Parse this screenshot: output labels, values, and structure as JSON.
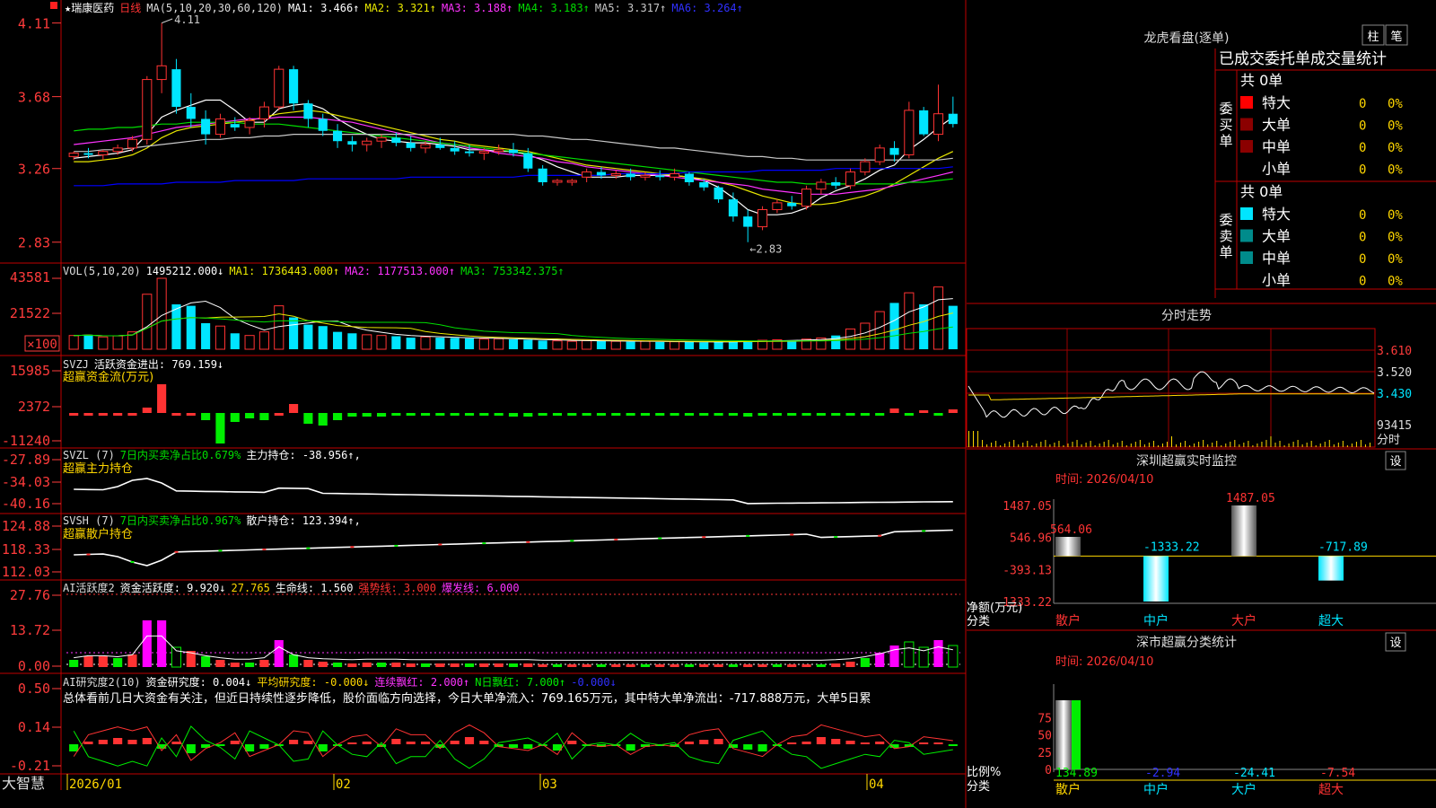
{
  "stock": {
    "name": "瑞康医药",
    "period": "日线",
    "star": "★"
  },
  "colors": {
    "up": "#ff3333",
    "down": "#00e5ff",
    "grid": "#9b0000",
    "panelBorder": "#c00000",
    "axis": "#ff3b3b",
    "ma1": "#ffffff",
    "ma2": "#e8e800",
    "ma3": "#ff33ff",
    "ma4": "#00dd00",
    "ma5": "#c8c8c8",
    "ma6": "#0000ff"
  },
  "main": {
    "header": [
      "MA(5,10,20,30,60,120)",
      "MA1: 3.466↑",
      "MA2: 3.321↑",
      "MA3: 3.188↑",
      "MA4: 3.183↑",
      "MA5: 3.317↑",
      "MA6: 3.264↑"
    ],
    "yTicks": [
      "4.11",
      "3.68",
      "3.26",
      "2.83"
    ],
    "highNote": "4.11",
    "lowNote": "←2.83",
    "ylim": [
      2.75,
      4.15
    ]
  },
  "vol": {
    "header": [
      "VOL(5,10,20)",
      "1495212.000↓",
      "MA1: 1736443.000↑",
      "MA2: 1177513.000↑",
      "MA3: 753342.375↑"
    ],
    "yTicks": [
      "43581",
      "21522",
      "×100"
    ]
  },
  "svzj": {
    "header": [
      "SVZJ",
      "活跃资金进出: 769.159↓"
    ],
    "title": "超赢资金流(万元)",
    "yTicks": [
      "15985",
      "2372",
      "-11240"
    ]
  },
  "svzl": {
    "header": [
      "SVZL (7)",
      "7日内买卖净占比0.679%",
      "主力持仓: -38.956↑,"
    ],
    "title": "超赢主力持仓",
    "yTicks": [
      "-27.89",
      "-34.03",
      "-40.16"
    ]
  },
  "svsh": {
    "header": [
      "SVSH (7)",
      "7日内买卖净占比0.967%",
      "散户持仓: 123.394↑,"
    ],
    "title": "超赢散户持仓",
    "yTicks": [
      "124.88",
      "118.33",
      "112.03"
    ]
  },
  "ai1": {
    "header": [
      "AI活跃度2",
      "资金活跃度: 9.920↓",
      "27.765",
      "生命线: 1.560",
      "强势线: 3.000",
      "爆发线: 6.000"
    ],
    "yTicks": [
      "27.76",
      "13.72",
      "0.00"
    ]
  },
  "ai2": {
    "header": [
      "AI研究度2(10)",
      "资金研究度: 0.004↓",
      "平均研究度: -0.000↓",
      "连续飘红: 2.000↑",
      "N日飘红: 7.000↑",
      "-0.000↓"
    ],
    "text": "总体看前几日大资金有关注，但近日持续性逐步降低，股价面临方向选择，今日大单净流入：769.165万元，其中特大单净流出：-717.888万元，大单5日累",
    "yTicks": [
      "0.50",
      "0.14",
      "-0.21"
    ]
  },
  "dateAxis": [
    "2026/01",
    "02",
    "03",
    "04"
  ],
  "brand": "大智慧",
  "right": {
    "title": "龙虎看盘(逐单)",
    "tabs": [
      "柱",
      "笔"
    ],
    "tableTitle": "已成交委托单成交量统计",
    "buy": {
      "side": "委买单",
      "total": "共 0单",
      "rows": [
        {
          "label": "特大",
          "val": "0",
          "pct": "0%"
        },
        {
          "label": "大单",
          "val": "0",
          "pct": "0%"
        },
        {
          "label": "中单",
          "val": "0",
          "pct": "0%"
        },
        {
          "label": "小单",
          "val": "0",
          "pct": "0%"
        }
      ]
    },
    "sell": {
      "side": "委卖单",
      "total": "共 0单",
      "rows": [
        {
          "label": "特大",
          "val": "0",
          "pct": "0%"
        },
        {
          "label": "大单",
          "val": "0",
          "pct": "0%"
        },
        {
          "label": "中单",
          "val": "0",
          "pct": "0%"
        },
        {
          "label": "小单",
          "val": "0",
          "pct": "0%"
        }
      ]
    },
    "intraday": {
      "title": "分时走势",
      "yTicks": [
        "3.610",
        "3.520",
        "3.430",
        "93415"
      ],
      "footer": "分时"
    },
    "monitor": {
      "title": "深圳超赢实时监控",
      "setBtn": "设",
      "date": "时间: 2026/04/10",
      "yTicks": [
        "1487.05",
        "546.96",
        "-393.13",
        "-1333.22"
      ],
      "ylabel": "净额(万元)",
      "xlabel": "分类",
      "categories": [
        "散户",
        "中户",
        "大户",
        "超大"
      ],
      "values": [
        564.06,
        -1333.22,
        1487.05,
        -717.89
      ],
      "valueLabels": [
        "564.06",
        "-1333.22",
        "1487.05",
        "-717.89"
      ]
    },
    "stats": {
      "title": "深市超赢分类统计",
      "setBtn": "设",
      "date": "时间: 2026/04/10",
      "yTicks": [
        "75",
        "50",
        "25",
        "0"
      ],
      "ylabel": "比例%",
      "xlabel": "分类",
      "categories": [
        "散户",
        "中户",
        "大户",
        "超大"
      ],
      "values": [
        134.89,
        -2.94,
        -24.41,
        -7.54
      ],
      "valueLabels": [
        "134.89",
        "-2.94",
        "-24.41",
        "-7.54"
      ]
    }
  },
  "chart_data": {
    "type": "candlestick",
    "title": "瑞康医药 日线",
    "x": [
      "2026/01",
      "02",
      "03",
      "04"
    ],
    "ylim": [
      2.75,
      4.15
    ],
    "high": 4.11,
    "low": 2.83,
    "ohlc": [
      [
        3.33,
        3.36,
        3.31,
        3.35
      ],
      [
        3.35,
        3.38,
        3.32,
        3.34
      ],
      [
        3.34,
        3.37,
        3.31,
        3.36
      ],
      [
        3.36,
        3.4,
        3.34,
        3.38
      ],
      [
        3.38,
        3.45,
        3.36,
        3.43
      ],
      [
        3.43,
        3.8,
        3.4,
        3.78
      ],
      [
        3.78,
        4.11,
        3.7,
        3.86
      ],
      [
        3.84,
        3.9,
        3.58,
        3.62
      ],
      [
        3.62,
        3.7,
        3.5,
        3.55
      ],
      [
        3.55,
        3.6,
        3.4,
        3.46
      ],
      [
        3.46,
        3.58,
        3.44,
        3.55
      ],
      [
        3.52,
        3.56,
        3.48,
        3.5
      ],
      [
        3.5,
        3.56,
        3.46,
        3.54
      ],
      [
        3.55,
        3.65,
        3.5,
        3.62
      ],
      [
        3.62,
        3.86,
        3.6,
        3.84
      ],
      [
        3.84,
        3.86,
        3.6,
        3.64
      ],
      [
        3.64,
        3.66,
        3.5,
        3.55
      ],
      [
        3.55,
        3.58,
        3.45,
        3.48
      ],
      [
        3.48,
        3.52,
        3.38,
        3.42
      ],
      [
        3.42,
        3.45,
        3.36,
        3.4
      ],
      [
        3.4,
        3.44,
        3.36,
        3.42
      ],
      [
        3.42,
        3.46,
        3.38,
        3.44
      ],
      [
        3.44,
        3.47,
        3.39,
        3.41
      ],
      [
        3.41,
        3.45,
        3.36,
        3.38
      ],
      [
        3.38,
        3.42,
        3.35,
        3.4
      ],
      [
        3.4,
        3.44,
        3.37,
        3.38
      ],
      [
        3.38,
        3.42,
        3.34,
        3.36
      ],
      [
        3.36,
        3.4,
        3.33,
        3.35
      ],
      [
        3.35,
        3.38,
        3.31,
        3.36
      ],
      [
        3.36,
        3.4,
        3.34,
        3.37
      ],
      [
        3.37,
        3.41,
        3.33,
        3.35
      ],
      [
        3.35,
        3.38,
        3.24,
        3.26
      ],
      [
        3.26,
        3.28,
        3.16,
        3.18
      ],
      [
        3.18,
        3.2,
        3.16,
        3.19
      ],
      [
        3.18,
        3.2,
        3.16,
        3.19
      ],
      [
        3.21,
        3.26,
        3.18,
        3.24
      ],
      [
        3.24,
        3.27,
        3.2,
        3.22
      ],
      [
        3.22,
        3.25,
        3.2,
        3.23
      ],
      [
        3.23,
        3.26,
        3.19,
        3.21
      ],
      [
        3.21,
        3.24,
        3.19,
        3.22
      ],
      [
        3.22,
        3.25,
        3.19,
        3.21
      ],
      [
        3.21,
        3.26,
        3.19,
        3.23
      ],
      [
        3.23,
        3.24,
        3.16,
        3.18
      ],
      [
        3.18,
        3.2,
        3.13,
        3.15
      ],
      [
        3.15,
        3.16,
        3.06,
        3.08
      ],
      [
        3.08,
        3.12,
        2.95,
        2.98
      ],
      [
        2.98,
        3.02,
        2.83,
        2.92
      ],
      [
        2.92,
        3.04,
        2.9,
        3.02
      ],
      [
        3.02,
        3.08,
        3.0,
        3.06
      ],
      [
        3.06,
        3.1,
        3.02,
        3.04
      ],
      [
        3.04,
        3.16,
        3.02,
        3.14
      ],
      [
        3.14,
        3.2,
        3.11,
        3.18
      ],
      [
        3.18,
        3.21,
        3.14,
        3.16
      ],
      [
        3.16,
        3.26,
        3.14,
        3.24
      ],
      [
        3.24,
        3.32,
        3.22,
        3.3
      ],
      [
        3.3,
        3.4,
        3.28,
        3.38
      ],
      [
        3.38,
        3.42,
        3.3,
        3.34
      ],
      [
        3.34,
        3.65,
        3.32,
        3.6
      ],
      [
        3.6,
        3.62,
        3.45,
        3.46
      ],
      [
        3.46,
        3.75,
        3.42,
        3.58
      ],
      [
        3.58,
        3.68,
        3.5,
        3.52
      ]
    ],
    "volume": [
      95,
      100,
      85,
      92,
      120,
      380,
      490,
      310,
      300,
      180,
      160,
      110,
      95,
      120,
      300,
      220,
      170,
      160,
      120,
      110,
      100,
      95,
      90,
      80,
      85,
      80,
      78,
      75,
      70,
      72,
      68,
      65,
      60,
      58,
      55,
      60,
      58,
      55,
      52,
      55,
      50,
      52,
      50,
      48,
      52,
      55,
      58,
      62,
      65,
      60,
      70,
      78,
      95,
      140,
      180,
      260,
      320,
      390,
      310,
      430,
      300
    ],
    "series": [
      {
        "name": "MA1",
        "values": [
          3.32,
          3.33,
          3.34,
          3.35,
          3.37,
          3.46,
          3.56,
          3.6,
          3.63,
          3.66,
          3.66,
          3.6,
          3.53,
          3.53,
          3.61,
          3.63,
          3.64,
          3.61,
          3.55,
          3.5,
          3.46,
          3.43,
          3.42,
          3.41,
          3.41,
          3.4,
          3.39,
          3.37,
          3.37,
          3.36,
          3.36,
          3.34,
          3.31,
          3.27,
          3.24,
          3.21,
          3.21,
          3.21,
          3.22,
          3.22,
          3.22,
          3.22,
          3.21,
          3.19,
          3.15,
          3.09,
          3.02,
          2.99,
          2.99,
          3.0,
          3.03,
          3.09,
          3.13,
          3.16,
          3.2,
          3.25,
          3.28,
          3.37,
          3.43,
          3.5,
          3.56
        ]
      },
      {
        "name": "MA2",
        "values": [
          3.3,
          3.3,
          3.31,
          3.32,
          3.34,
          3.38,
          3.44,
          3.48,
          3.5,
          3.51,
          3.52,
          3.53,
          3.54,
          3.56,
          3.58,
          3.59,
          3.6,
          3.59,
          3.57,
          3.55,
          3.53,
          3.51,
          3.49,
          3.47,
          3.45,
          3.43,
          3.42,
          3.4,
          3.39,
          3.38,
          3.37,
          3.36,
          3.34,
          3.32,
          3.3,
          3.28,
          3.27,
          3.26,
          3.25,
          3.24,
          3.23,
          3.22,
          3.21,
          3.2,
          3.18,
          3.16,
          3.13,
          3.1,
          3.08,
          3.06,
          3.05,
          3.05,
          3.06,
          3.08,
          3.1,
          3.13,
          3.17,
          3.22,
          3.27,
          3.32,
          3.36
        ]
      },
      {
        "name": "MA3",
        "values": [
          3.4,
          3.41,
          3.42,
          3.43,
          3.44,
          3.46,
          3.48,
          3.5,
          3.51,
          3.52,
          3.53,
          3.54,
          3.55,
          3.55,
          3.56,
          3.56,
          3.56,
          3.55,
          3.54,
          3.53,
          3.51,
          3.49,
          3.47,
          3.45,
          3.43,
          3.41,
          3.4,
          3.38,
          3.37,
          3.35,
          3.34,
          3.33,
          3.32,
          3.3,
          3.29,
          3.27,
          3.26,
          3.25,
          3.24,
          3.23,
          3.22,
          3.21,
          3.2,
          3.19,
          3.18,
          3.17,
          3.16,
          3.14,
          3.13,
          3.12,
          3.11,
          3.11,
          3.11,
          3.12,
          3.13,
          3.14,
          3.16,
          3.18,
          3.2,
          3.22,
          3.24
        ]
      },
      {
        "name": "MA4",
        "values": [
          3.48,
          3.49,
          3.49,
          3.5,
          3.5,
          3.51,
          3.52,
          3.52,
          3.53,
          3.53,
          3.53,
          3.53,
          3.52,
          3.52,
          3.52,
          3.51,
          3.5,
          3.49,
          3.48,
          3.47,
          3.46,
          3.45,
          3.44,
          3.43,
          3.42,
          3.41,
          3.4,
          3.39,
          3.38,
          3.37,
          3.36,
          3.35,
          3.34,
          3.33,
          3.32,
          3.31,
          3.3,
          3.29,
          3.28,
          3.27,
          3.26,
          3.25,
          3.24,
          3.23,
          3.22,
          3.21,
          3.2,
          3.19,
          3.18,
          3.18,
          3.17,
          3.17,
          3.17,
          3.17,
          3.17,
          3.17,
          3.17,
          3.18,
          3.18,
          3.19,
          3.2
        ]
      },
      {
        "name": "MA5",
        "values": [
          3.36,
          3.36,
          3.37,
          3.37,
          3.38,
          3.39,
          3.4,
          3.41,
          3.42,
          3.43,
          3.43,
          3.44,
          3.44,
          3.45,
          3.45,
          3.46,
          3.46,
          3.46,
          3.46,
          3.46,
          3.46,
          3.46,
          3.46,
          3.46,
          3.46,
          3.46,
          3.46,
          3.46,
          3.46,
          3.46,
          3.46,
          3.45,
          3.45,
          3.44,
          3.43,
          3.43,
          3.42,
          3.41,
          3.4,
          3.39,
          3.38,
          3.38,
          3.37,
          3.36,
          3.35,
          3.34,
          3.33,
          3.33,
          3.32,
          3.32,
          3.31,
          3.31,
          3.31,
          3.31,
          3.31,
          3.31,
          3.31,
          3.31,
          3.31,
          3.31,
          3.32
        ]
      },
      {
        "name": "MA6",
        "values": [
          3.16,
          3.16,
          3.16,
          3.17,
          3.17,
          3.17,
          3.17,
          3.18,
          3.18,
          3.18,
          3.18,
          3.19,
          3.19,
          3.19,
          3.19,
          3.19,
          3.2,
          3.2,
          3.2,
          3.2,
          3.2,
          3.2,
          3.2,
          3.21,
          3.21,
          3.21,
          3.21,
          3.21,
          3.21,
          3.21,
          3.21,
          3.22,
          3.22,
          3.22,
          3.22,
          3.22,
          3.22,
          3.23,
          3.23,
          3.23,
          3.23,
          3.23,
          3.24,
          3.24,
          3.24,
          3.24,
          3.24,
          3.25,
          3.25,
          3.25,
          3.25,
          3.25,
          3.26,
          3.26,
          3.26,
          3.26,
          3.26,
          3.26,
          3.26,
          3.26,
          3.27
        ]
      }
    ]
  }
}
